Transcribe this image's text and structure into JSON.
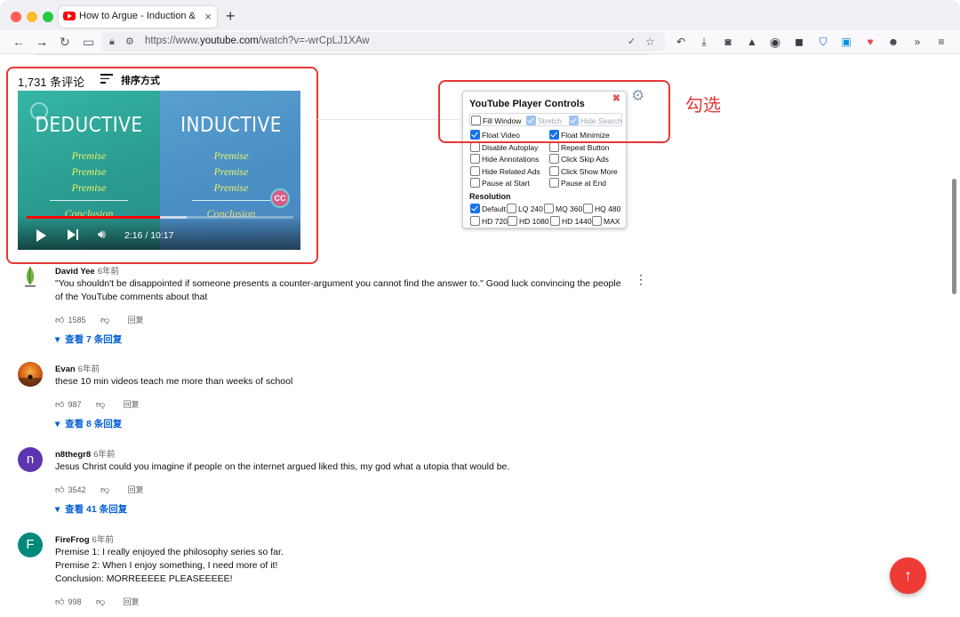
{
  "browser": {
    "tab_title": "How to Argue - Induction & Abduction",
    "tab_close": "×",
    "new_tab": "+",
    "url_prefix": "https://www.",
    "url_domain": "youtube.com",
    "url_path": "/watch?v=-wrCpLJ1XAw"
  },
  "comments_header": {
    "count": "1,731 条评论",
    "sort_label": "排序方式"
  },
  "video": {
    "left_heading": "DEDUCTIVE",
    "right_heading": "INDUCTIVE",
    "premise": "Premise",
    "conclusion": "Conclusion",
    "cc": "CC",
    "time": "2:16 / 10:17",
    "progress_fraction": 0.5,
    "buffer_fraction": 0.6
  },
  "annotation": "勾选",
  "panel": {
    "title": "YouTube Player Controls",
    "close": "✖",
    "options_top": [
      {
        "label": "Fill Window",
        "checked": false,
        "disabled": false
      },
      {
        "label": "Stretch",
        "checked": true,
        "disabled": true
      },
      {
        "label": "Hide Search",
        "checked": true,
        "disabled": true
      }
    ],
    "options_left": [
      {
        "label": "Float Video",
        "checked": true
      },
      {
        "label": "Disable Autoplay",
        "checked": false
      },
      {
        "label": "Hide Annotations",
        "checked": false
      },
      {
        "label": "Hide Related Ads",
        "checked": false
      },
      {
        "label": "Pause at Start",
        "checked": false
      }
    ],
    "options_right": [
      {
        "label": "Float Minimize",
        "checked": true
      },
      {
        "label": "Repeat Button",
        "checked": false
      },
      {
        "label": "Click Skip Ads",
        "checked": false
      },
      {
        "label": "Click Show More",
        "checked": false
      },
      {
        "label": "Pause at End",
        "checked": false
      }
    ],
    "resolution_label": "Resolution",
    "resolutions_row1": [
      {
        "label": "Default",
        "checked": true
      },
      {
        "label": "LQ 240",
        "checked": false
      },
      {
        "label": "MQ 360",
        "checked": false
      },
      {
        "label": "HQ 480",
        "checked": false
      }
    ],
    "resolutions_row2": [
      {
        "label": "HD 720",
        "checked": false
      },
      {
        "label": "HD 1080",
        "checked": false
      },
      {
        "label": "HD 1440",
        "checked": false
      },
      {
        "label": "MAX",
        "checked": false
      }
    ]
  },
  "comments": [
    {
      "author": "David Yee",
      "time": "6年前",
      "text": "\"You shouldn't be disappointed if someone presents a counter-argument you cannot find the answer to.\" Good luck convincing the people of the YouTube comments about that",
      "likes": "1585",
      "reply": "回复",
      "replies": "查看 7 条回复"
    },
    {
      "author": "Evan",
      "time": "6年前",
      "text": "these 10 min videos teach me more than weeks of school",
      "likes": "987",
      "reply": "回复",
      "replies": "查看 8 条回复"
    },
    {
      "author": "n8thegr8",
      "time": "6年前",
      "avatar_letter": "n",
      "text": "Jesus Christ could you imagine if people on the internet argued liked this, my god what a utopia that would be.",
      "likes": "3542",
      "reply": "回复",
      "replies": "查看 41 条回复"
    },
    {
      "author": "FireFrog",
      "time": "6年前",
      "avatar_letter": "F",
      "text_lines": [
        "Premise 1: I really enjoyed the philosophy series so far.",
        "Premise 2: When I enjoy something, I need more of it!",
        "Conclusion: MORREEEEE PLEASEEEEE!"
      ],
      "likes": "998",
      "reply": "回复"
    }
  ],
  "colors": {
    "accent_red": "#e53935",
    "link_blue": "#065fd4",
    "avatar_n": "#5e35b1",
    "avatar_f": "#00897b",
    "fab": "#ef3a36"
  }
}
